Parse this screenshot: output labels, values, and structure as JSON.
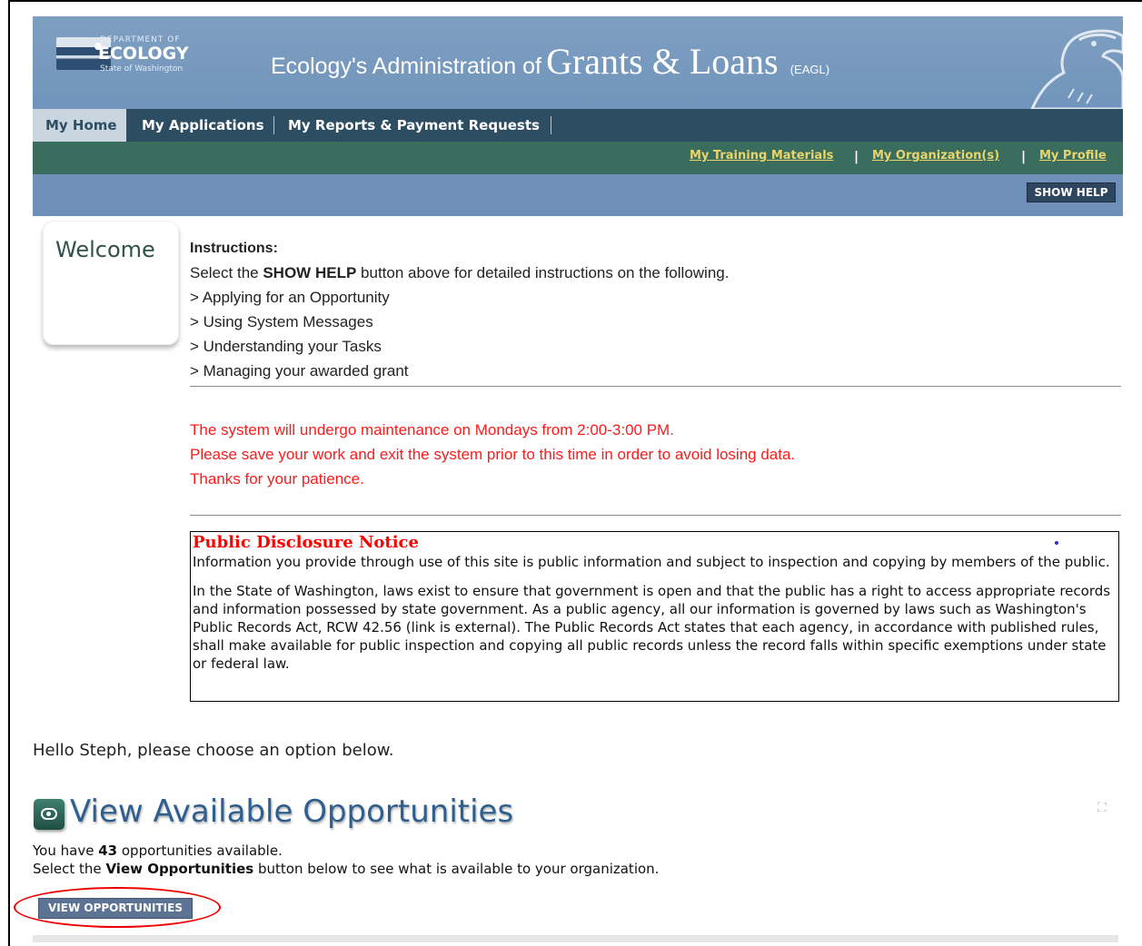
{
  "banner": {
    "logo_dept": "DEPARTMENT OF",
    "logo_name": "ECOLOGY",
    "logo_state": "State of Washington",
    "title_part1": "Ecology's Administration of",
    "title_part2": "Grants & Loans",
    "title_part3": "(EAGL)"
  },
  "nav": {
    "tabs": [
      {
        "label": "My Home",
        "active": true
      },
      {
        "label": "My Applications",
        "active": false
      },
      {
        "label": "My Reports & Payment Requests",
        "active": false
      }
    ]
  },
  "subnav": {
    "links": [
      "My Training Materials",
      "My Organization(s)",
      "My Profile"
    ],
    "separator": "|"
  },
  "helpbar": {
    "button": "SHOW HELP"
  },
  "welcome": {
    "label": "Welcome"
  },
  "instructions": {
    "heading": "Instructions:",
    "intro_pre": "Select the",
    "intro_bold": "SHOW HELP",
    "intro_post": "button above for detailed instructions on the following.",
    "items": [
      "> Applying for an Opportunity",
      "> Using System Messages",
      "> Understanding your Tasks",
      "> Managing your awarded grant"
    ]
  },
  "maintenance": [
    "The system will undergo maintenance on Mondays from 2:00-3:00 PM.",
    "Please save your work and exit the system prior to this time in order to avoid losing data.",
    "Thanks for your patience."
  ],
  "disclosure": {
    "title": "Public Disclosure Notice",
    "para1": "Information you provide through use of this site is public information and subject to inspection and copying by members of the public.",
    "para2_pre": "In the State of Washington, laws exist to ensure that government is open and that the public has a right to access appropriate records and information possessed by state government. As a public agency, all our information is governed by laws such as Washington's Public Records Act,",
    "para2_link": "RCW 42.56",
    "para2_post": "(link is external). The Public Records Act states that each agency, in accordance with published rules, shall make available for public inspection and copying all public records unless the record falls within specific exemptions under state or federal law."
  },
  "greeting": "Hello Steph, please choose an option below.",
  "opportunities": {
    "title": "View Available Opportunities",
    "count_pre": "You have",
    "count": "43",
    "count_post": "opportunities available.",
    "select_pre": "Select the",
    "select_bold": "View Opportunities",
    "select_post": "button below to see what is available to your organization.",
    "button": "VIEW OPPORTUNITIES"
  },
  "colors": {
    "banner": "#7094bb",
    "nav": "#2d4d62",
    "subnav": "#3b6d5e",
    "link": "#e9d56b",
    "alert": "#ff1a1a",
    "highlight_circle": "#ee0000"
  }
}
